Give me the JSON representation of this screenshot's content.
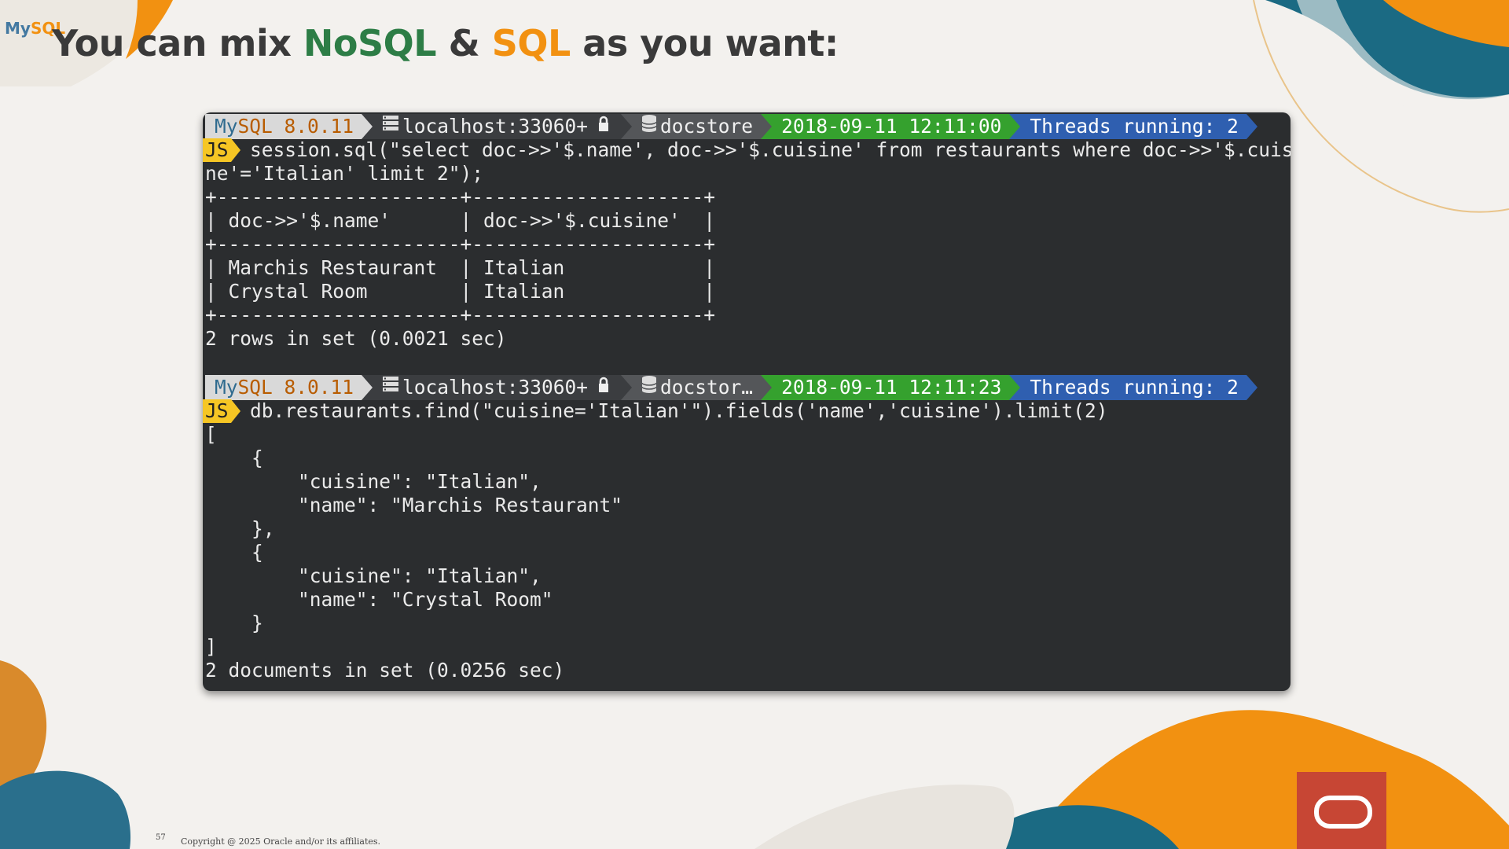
{
  "slide": {
    "logo": {
      "part1": "My",
      "part2": "SQL"
    },
    "title": {
      "pre": "You can mix ",
      "nosql": "NoSQL",
      "amp": " & ",
      "sql": "SQL",
      "post": " as you want:"
    },
    "page_number": "57",
    "copyright": "Copyright @ 2025 Oracle and/or its affiliates."
  },
  "colors": {
    "nosql": "#2d7d46",
    "sql": "#f29111",
    "terminal_bg": "#2b2d2f",
    "prompt_time": "#35a12e",
    "prompt_threads": "#2f5fb0",
    "js_badge": "#f6c624",
    "oracle_red": "#c74634"
  },
  "terminal": {
    "prompt1": {
      "version_my": "My",
      "version_rest": "SQL 8.0.11",
      "host": "localhost:33060+",
      "host_icon": "server-icon",
      "lock_icon": "lock-icon",
      "schema": "docstore",
      "schema_icon": "database-icon",
      "time": "2018-09-11 12:11:00",
      "threads": "Threads running: 2"
    },
    "js_label": "JS",
    "cmd1_line1": "session.sql(\"select doc->>'$.name', doc->>'$.cuisine' from restaurants where doc->>'$.cuisi",
    "cmd1_line2": "ne'='Italian' limit 2\");",
    "table": {
      "border": "+---------------------+--------------------+",
      "header": "| doc->>'$.name'      | doc->>'$.cuisine'  |",
      "rows": [
        "| Marchis Restaurant  | Italian            |",
        "| Crystal Room        | Italian            |"
      ]
    },
    "result1": "2 rows in set (0.0021 sec)",
    "prompt2": {
      "version_my": "My",
      "version_rest": "SQL 8.0.11",
      "host": "localhost:33060+",
      "schema": "docstor…",
      "time": "2018-09-11 12:11:23",
      "threads": "Threads running: 2"
    },
    "cmd2": "db.restaurants.find(\"cuisine='Italian'\").fields('name','cuisine').limit(2)",
    "json_lines": [
      "[",
      "    {",
      "        \"cuisine\": \"Italian\",",
      "        \"name\": \"Marchis Restaurant\"",
      "    },",
      "    {",
      "        \"cuisine\": \"Italian\",",
      "        \"name\": \"Crystal Room\"",
      "    }",
      "]"
    ],
    "result2": "2 documents in set (0.0256 sec)"
  }
}
